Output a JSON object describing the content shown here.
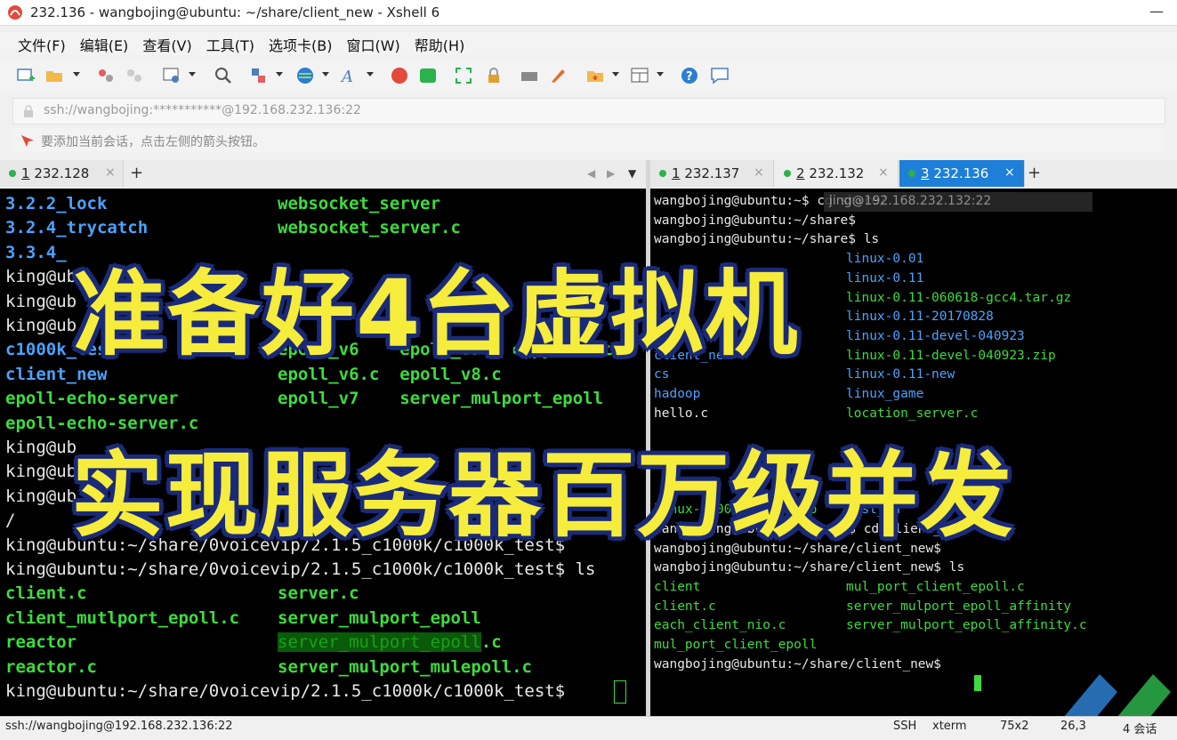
{
  "window": {
    "title": "232.136 - wangbojing@ubuntu: ~/share/client_new - Xshell 6",
    "minimize": "—",
    "maximize": "☐"
  },
  "menu": [
    "文件(F)",
    "编辑(E)",
    "查看(V)",
    "工具(T)",
    "选项卡(B)",
    "窗口(W)",
    "帮助(H)"
  ],
  "address": "ssh://wangbojing:***********@192.168.232.136:22",
  "hint": "要添加当前会话，点击左侧的箭头按钮。",
  "left_tabs": [
    {
      "num": "1",
      "label": " 232.128",
      "close": "×"
    }
  ],
  "right_tabs": [
    {
      "num": "1",
      "label": " 232.137",
      "close": "×"
    },
    {
      "num": "2",
      "label": " 232.132",
      "close": "×"
    },
    {
      "num": "3",
      "label": " 232.136",
      "close": "×"
    }
  ],
  "plus": "+",
  "left_terminal": [
    {
      "a": "3.2.2_lock",
      "b": "websocket_server",
      "ca": "c-cyan",
      "cb": "c-green"
    },
    {
      "a": "3.2.4_trycatch",
      "b": "websocket_server.c",
      "ca": "c-cyan",
      "cb": "c-green"
    },
    {
      "a": "3.3.4_",
      "b": "",
      "ca": "c-cyan",
      "cb": "c-green"
    },
    {
      "a": "king@ub",
      "b": "",
      "ca": "c-white",
      "cb": "c-white"
    },
    {
      "a": "king@ub",
      "b": "",
      "ca": "c-white",
      "cb": "c-white"
    },
    {
      "a": "king@ub",
      "b": "",
      "ca": "c-white",
      "cb": "c-white"
    },
    {
      "a": "c1000k_test",
      "b": "epoll_v6    epoll_v7 - copy (2).c",
      "ca": "c-cyan",
      "cb": "c-green"
    },
    {
      "a": "client_new",
      "b": "epoll_v6.c  epoll_v8.c",
      "ca": "c-cyan",
      "cb": "c-green"
    },
    {
      "a": "epoll-echo-server",
      "b": "epoll_v7    server_mulport_epoll",
      "ca": "c-green",
      "cb": "c-green"
    },
    {
      "a": "epoll-echo-server.c",
      "b": "",
      "ca": "c-green",
      "cb": "c-green"
    },
    {
      "a": "king@ub",
      "b": "",
      "ca": "c-white",
      "cb": "c-white"
    },
    {
      "a": "king@ub",
      "b": "",
      "ca": "c-white",
      "cb": "c-white"
    },
    {
      "a": "king@ub",
      "b": "",
      "ca": "c-white",
      "cb": "c-white"
    },
    {
      "a": "/",
      "b": "",
      "ca": "c-white",
      "cb": "c-white"
    },
    {
      "a": "king@ubuntu:~/share/0voicevip/2.1.5_c1000k/c1000k_test$",
      "b": "",
      "ca": "c-white",
      "cb": "c-white"
    },
    {
      "a": "king@ubuntu:~/share/0voicevip/2.1.5_c1000k/c1000k_test$ ls",
      "b": "",
      "ca": "c-white",
      "cb": "c-white"
    },
    {
      "a": "client.c",
      "b": "server.c",
      "ca": "c-green",
      "cb": "c-green"
    },
    {
      "a": "client_mutlport_epoll.c",
      "b": "server_mulport_epoll",
      "ca": "c-green",
      "cb": "c-green"
    },
    {
      "a": "reactor",
      "b": "server_mulport_epoll",
      "ca": "c-green",
      "cb": "hl",
      "tail": ".c"
    },
    {
      "a": "reactor.c",
      "b": "server_mulport_mulepoll.c",
      "ca": "c-green",
      "cb": "c-green"
    },
    {
      "a": "king@ubuntu:~/share/0voicevip/2.1.5_c1000k/c1000k_test$ ",
      "b": "",
      "ca": "c-white",
      "cb": "c-white"
    }
  ],
  "right_terminal": [
    {
      "a": "wangbojing@ubuntu:~$ cd share/",
      "b": "",
      "ca": "c-white",
      "cb": "c-white"
    },
    {
      "a": "wangbojing@ubuntu:~/share$",
      "b": "",
      "ca": "c-white",
      "cb": "c-white"
    },
    {
      "a": "wangbojing@ubuntu:~/share$ ls",
      "b": "",
      "ca": "c-white",
      "cb": "c-white"
    },
    {
      "a": "",
      "b": "linux-0.01",
      "ca": "c-blue",
      "cb": "c-blue"
    },
    {
      "a": "",
      "b": "linux-0.11",
      "ca": "c-blue",
      "cb": "c-blue"
    },
    {
      "a": "",
      "b": "linux-0.11-060618-gcc4.tar.gz",
      "ca": "c-blue",
      "cb": "c-rgreen"
    },
    {
      "a": "",
      "b": "linux-0.11-20170828",
      "ca": "c-blue",
      "cb": "c-blue"
    },
    {
      "a": "",
      "b": "linux-0.11-devel-040923",
      "ca": "c-blue",
      "cb": "c-blue"
    },
    {
      "a": "client_new",
      "b": "linux-0.11-devel-040923.zip",
      "ca": "c-blue",
      "cb": "c-rgreen"
    },
    {
      "a": "cs",
      "b": "linux-0.11-new",
      "ca": "c-blue",
      "cb": "c-blue"
    },
    {
      "a": "hadoop",
      "b": "linux_game",
      "ca": "c-blue",
      "cb": "c-blue"
    },
    {
      "a": "hello.c",
      "b": "location_server.c",
      "ca": "c-white",
      "cb": "c-rgreen"
    },
    {
      "a": "",
      "b": "",
      "ca": "c-white",
      "cb": "c-white"
    },
    {
      "a": "",
      "b": "",
      "ca": "c-white",
      "cb": "c-white"
    },
    {
      "a": "",
      "b": "",
      "ca": "c-white",
      "cb": "c-white"
    },
    {
      "a": "",
      "b": "",
      "ca": "c-white",
      "cb": "c-white"
    },
    {
      "a": "linux-0.00-050613.zip",
      "b": "test_hd",
      "ca": "c-rgreen",
      "cb": "c-blue"
    },
    {
      "a": "wangbojing@ubuntu:~/share$ cd client_new/",
      "b": "",
      "ca": "c-white",
      "cb": "c-white"
    },
    {
      "a": "wangbojing@ubuntu:~/share/client_new$",
      "b": "",
      "ca": "c-white",
      "cb": "c-white"
    },
    {
      "a": "wangbojing@ubuntu:~/share/client_new$ ls",
      "b": "",
      "ca": "c-white",
      "cb": "c-white"
    },
    {
      "a": "client",
      "b": "mul_port_client_epoll.c",
      "ca": "c-rgreen",
      "cb": "c-rgreen"
    },
    {
      "a": "client.c",
      "b": "server_mulport_epoll_affinity",
      "ca": "c-rgreen",
      "cb": "c-rgreen"
    },
    {
      "a": "each_client_nio.c",
      "b": "server_mulport_epoll_affinity.c",
      "ca": "c-rgreen",
      "cb": "c-rgreen"
    },
    {
      "a": "mul_port_client_epoll",
      "b": "",
      "ca": "c-rgreen",
      "cb": "c-rgreen"
    },
    {
      "a": "wangbojing@ubuntu:~/share/client_new$ ",
      "b": "",
      "ca": "c-white",
      "cb": "c-white"
    }
  ],
  "tooltip": "jing@192.168.232.132:22",
  "captions": {
    "line1": "准备好4台虚拟机",
    "line2": "实现服务器百万级并发"
  },
  "status": {
    "address": "ssh://wangbojing@192.168.232.136:22",
    "protocol": "SSH",
    "term": "xterm",
    "size": "75x2",
    "pos": "26,3",
    "sessions": "4 会话"
  },
  "colors": {
    "accent": "#1e7fd8",
    "caption": "#f6ec3c",
    "terminal_bg": "#000000"
  }
}
